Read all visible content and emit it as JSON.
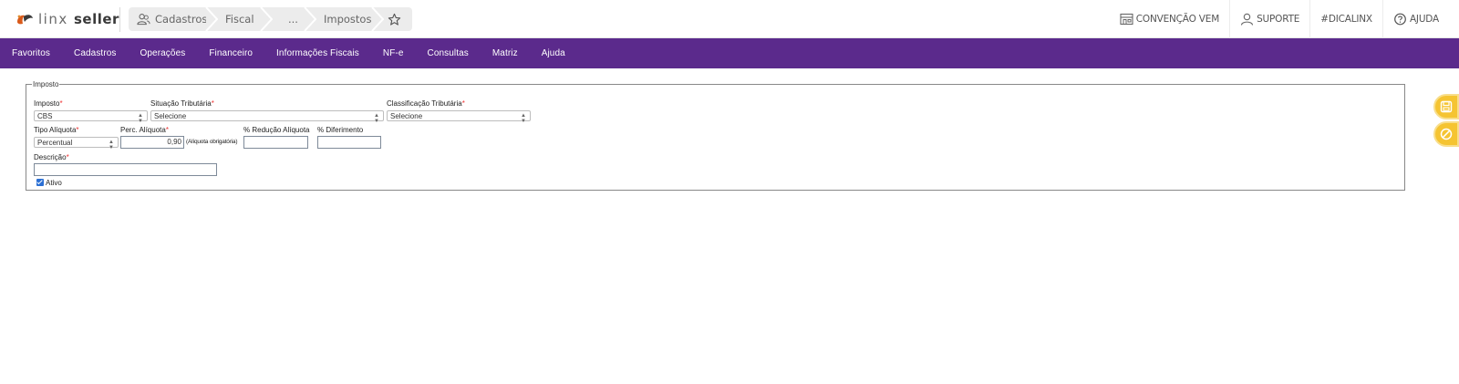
{
  "header": {
    "logo": {
      "light": "linx",
      "bold": "seller"
    },
    "breadcrumb": [
      "Cadastros",
      "Fiscal",
      "...",
      "Impostos"
    ],
    "links": [
      {
        "icon": "store-icon",
        "label": "CONVENÇÃO VEM"
      },
      {
        "icon": "user-icon",
        "label": "SUPORTE"
      },
      {
        "icon": "",
        "label": "#DICALINX"
      },
      {
        "icon": "help-icon",
        "label": "AJUDA"
      }
    ]
  },
  "menu": [
    "Favoritos",
    "Cadastros",
    "Operações",
    "Financeiro",
    "Informações Fiscais",
    "NF-e",
    "Consultas",
    "Matriz",
    "Ajuda"
  ],
  "form": {
    "legend": "Imposto",
    "imposto": {
      "label": "Imposto",
      "required_mark": "*",
      "value": "CBS"
    },
    "situacao": {
      "label": "Situação Tributária",
      "required_mark": "*",
      "value": "Selecione"
    },
    "classificacao": {
      "label": "Classificação Tributária",
      "required_mark": "*",
      "value": "Selecione"
    },
    "tipo_aliquota": {
      "label": "Tipo Alíquota",
      "required_mark": "*",
      "value": "Percentual"
    },
    "perc_aliquota": {
      "label": "Perc. Alíquota",
      "required_mark": "*",
      "value": "0,90",
      "hint": "(Alíquota obrigatória)"
    },
    "reducao": {
      "label": "% Redução Alíquota",
      "value": ""
    },
    "diferimento": {
      "label": "% Diferimento",
      "value": ""
    },
    "descricao": {
      "label": "Descrição",
      "required_mark": "*",
      "value": ""
    },
    "ativo": {
      "label": "Ativo",
      "checked": true
    }
  },
  "colors": {
    "menu_bg": "#5b2a8c",
    "accent_float": "#f5c432",
    "required": "#e33333",
    "checkbox": "#2b6fd4"
  }
}
